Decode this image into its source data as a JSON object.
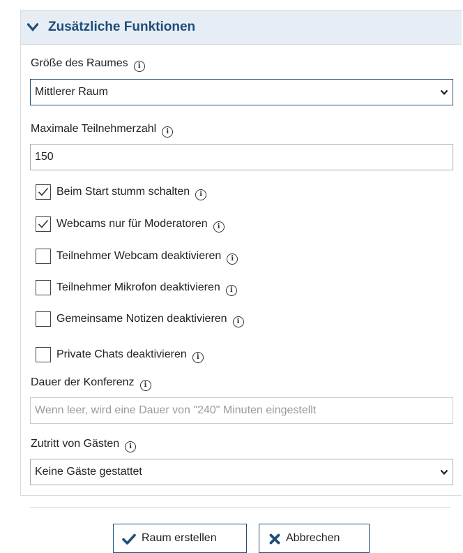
{
  "panel": {
    "title": "Zusätzliche Funktionen"
  },
  "room_size": {
    "label": "Größe des Raumes",
    "value": "Mittlerer Raum"
  },
  "max_participants": {
    "label": "Maximale Teilnehmerzahl",
    "value": "150"
  },
  "checkboxes": [
    {
      "label": "Beim Start stumm schalten",
      "checked": true
    },
    {
      "label": "Webcams nur für Moderatoren",
      "checked": true
    },
    {
      "label": "Teilnehmer Webcam deaktivieren",
      "checked": false
    },
    {
      "label": "Teilnehmer Mikrofon deaktivieren",
      "checked": false
    },
    {
      "label": "Gemeinsame Notizen deaktivieren",
      "checked": false
    },
    {
      "label": "Private Chats deaktivieren",
      "checked": false
    }
  ],
  "duration": {
    "label": "Dauer der Konferenz",
    "placeholder": "Wenn leer, wird eine Dauer von \"240\" Minuten eingestellt",
    "value": ""
  },
  "guest_access": {
    "label": "Zutritt von Gästen",
    "value": "Keine Gäste gestattet"
  },
  "buttons": {
    "create": "Raum erstellen",
    "cancel": "Abbrechen"
  },
  "icons": {
    "info": "ⓘ",
    "info_name": "info-icon",
    "chevron": "chevron-down-icon",
    "check": "check-icon",
    "close": "x-icon"
  },
  "colors": {
    "header_bg": "#e6edf4",
    "accent": "#1f4e79"
  }
}
